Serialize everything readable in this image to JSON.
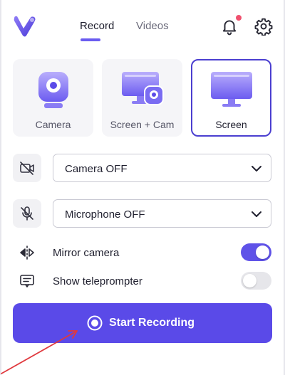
{
  "header": {
    "logo_icon": "brand-v-logo",
    "tabs": [
      {
        "label": "Record",
        "active": true
      },
      {
        "label": "Videos",
        "active": false
      }
    ],
    "bell_icon": "bell-icon",
    "notification_dot": true,
    "settings_icon": "gear-icon"
  },
  "modes": [
    {
      "label": "Camera",
      "icon": "camera-mode-icon",
      "selected": false
    },
    {
      "label": "Screen + Cam",
      "icon": "screen-cam-mode-icon",
      "selected": false
    },
    {
      "label": "Screen",
      "icon": "screen-mode-icon",
      "selected": true
    }
  ],
  "camera_select": {
    "icon": "camera-off-icon",
    "value": "Camera OFF"
  },
  "microphone_select": {
    "icon": "mic-off-icon",
    "value": "Microphone OFF"
  },
  "toggles": [
    {
      "label": "Mirror camera",
      "icon": "mirror-icon",
      "on": true
    },
    {
      "label": "Show teleprompter",
      "icon": "teleprompter-icon",
      "on": false
    }
  ],
  "start_button": {
    "label": "Start Recording",
    "icon": "record-icon"
  },
  "colors": {
    "accent": "#5a4ae8",
    "selected_border": "#4b3fd0",
    "notification": "#f0506e",
    "annotation_arrow": "#e0393e"
  }
}
